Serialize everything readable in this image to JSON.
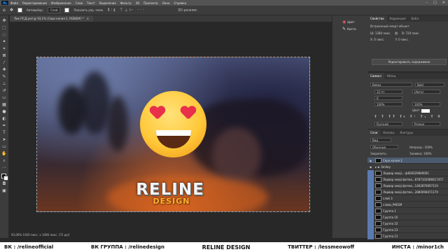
{
  "menubar": {
    "logo": "Ps",
    "items": [
      "Файл",
      "Редактирование",
      "Изображение",
      "Слои",
      "Текст",
      "Выделение",
      "Фильтр",
      "3D",
      "Просмотр",
      "Окно",
      "Справка"
    ]
  },
  "optbar": {
    "autoselect_label": "Автовыбор:",
    "autoselect_value": "Слой",
    "transform_label": "Показать упр. элем."
  },
  "document": {
    "tab_title": "Лик ПСД.psd @ 93,1% (Серо копия 2, RGB/8#) *"
  },
  "status": {
    "zoom_info": "93,06%   1920 пикс. x 1080 пикс. (72 ppi)"
  },
  "artwork": {
    "logo_main": "RELINE",
    "logo_sub": "DESIGN"
  },
  "sidepanel": {
    "items": [
      "Цвет",
      "Кисти"
    ]
  },
  "properties": {
    "tabs": [
      "Свойства",
      "Коррекция",
      "Библ."
    ],
    "smart_object": "Встроенный смарт-объект",
    "w_label": "Ш:",
    "w_value": "1280 пикс.",
    "h_label": "В:",
    "h_value": "720 пикс.",
    "x_value": "0 пикс.",
    "y_value": "0 пикс.",
    "button": "Редактировать содержимое"
  },
  "character": {
    "tabs": [
      "Символ",
      "Абзац"
    ],
    "font": "Bebas",
    "style": "Bold",
    "size": "12 пт",
    "leading": "(Авто)",
    "tracking": "0",
    "scale_v": "100%",
    "scale_h": "100%",
    "color_label": "Цвет:",
    "lang": "Русский",
    "aa": "Резкое"
  },
  "layers": {
    "tabs": [
      "Слои",
      "Каналы",
      "Контуры"
    ],
    "search_placeholder": "Вид",
    "blend": "Обычные",
    "opacity_label": "Непрозр.:",
    "opacity_value": "100%",
    "fill_label": "Заливка:",
    "fill_value": "100%",
    "lock_label": "Закрепить:",
    "rows": [
      "Серо копия 2",
      "Smiley",
      "Laptop emoji-...",
      "Закрыть emoji-....",
      "Laptop emoji-...",
      "слой 3",
      "Laptop emoji ...",
      "Laptop emoji-фон...",
      "Laptop emoji-...",
      "Цвет PSD",
      "Eyes",
      "Eyes 3",
      "Eyes 2",
      "Laptop emoji-..."
    ],
    "rows_full": [
      "Серо копия 2",
      "Smiley",
      "Лорвар емоji-...ф826029869001",
      "Лорвар емоji-фотма...8787102086617457",
      "Лорвар емоji-фотма...1462876097119",
      "Лорвар емоji-фотма...2880098471179",
      "слой 3",
      "слово_PAESM",
      "Группа 1",
      "Группа 16",
      "Группа 32",
      "Группа 23",
      "Группа 21",
      "Лорвар емоji-фон...0201003412019"
    ]
  },
  "footer": {
    "vk": "ВК : /relineofficial",
    "vk_group": "ВК ГРУППА : /relinedesign",
    "brand": "RELINE DESIGN",
    "twitter": "ТВИТТЕР : /lessmeowoff",
    "insta": "ИНСТА : /minor1ch"
  }
}
